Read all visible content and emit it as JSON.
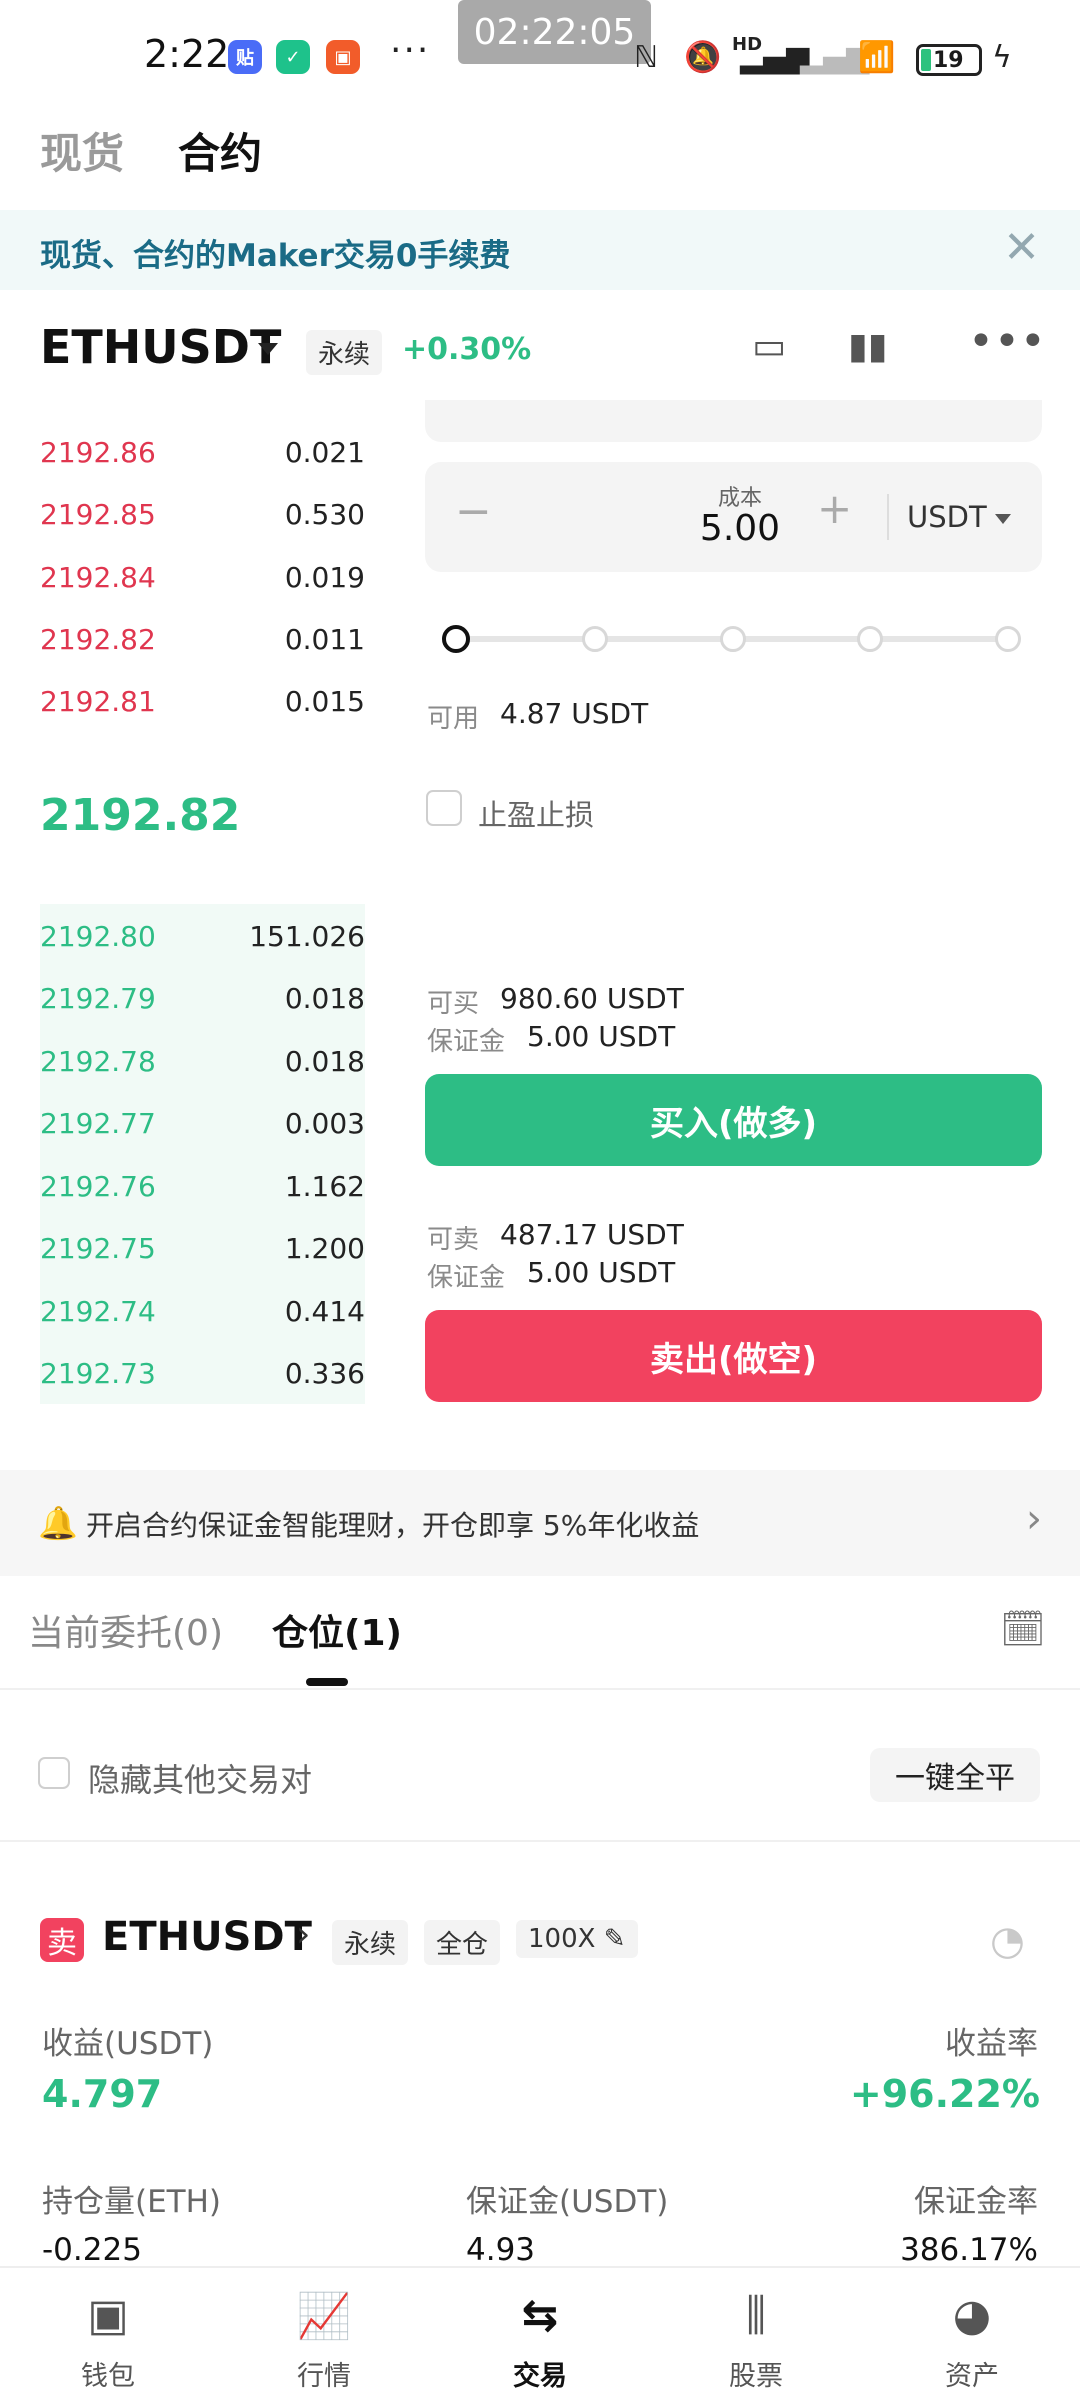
{
  "status_bar": {
    "time": "2:22",
    "dots": "···",
    "recording_clock": "02:22:05",
    "nfc": "ℕ",
    "hd": "HD",
    "battery": "19"
  },
  "top_tabs": [
    "现货",
    "合约"
  ],
  "banner": {
    "text": "现货、合约的Maker交易0手续费",
    "close": "✕"
  },
  "symbol": {
    "name": "ETHUSDT",
    "tag": "永续",
    "change": "+0.30%"
  },
  "order_book": {
    "asks": [
      {
        "price": "2192.86",
        "qty": "0.021"
      },
      {
        "price": "2192.85",
        "qty": "0.530"
      },
      {
        "price": "2192.84",
        "qty": "0.019"
      },
      {
        "price": "2192.82",
        "qty": "0.011"
      },
      {
        "price": "2192.81",
        "qty": "0.015"
      }
    ],
    "last_price": "2192.82",
    "bids": [
      {
        "price": "2192.80",
        "qty": "151.026"
      },
      {
        "price": "2192.79",
        "qty": "0.018"
      },
      {
        "price": "2192.78",
        "qty": "0.018"
      },
      {
        "price": "2192.77",
        "qty": "0.003"
      },
      {
        "price": "2192.76",
        "qty": "1.162"
      },
      {
        "price": "2192.75",
        "qty": "1.200"
      },
      {
        "price": "2192.74",
        "qty": "0.414"
      },
      {
        "price": "2192.73",
        "qty": "0.336"
      }
    ]
  },
  "order_form": {
    "cost_label": "成本",
    "cost_value": "5.00",
    "minus": "−",
    "plus": "+",
    "unit": "USDT",
    "available_label": "可用",
    "available_value": "4.87 USDT",
    "tpsl_label": "止盈止损",
    "can_buy_label": "可买",
    "can_buy_value": "980.60 USDT",
    "margin_label": "保证金",
    "buy_margin_value": "5.00 USDT",
    "buy_button": "买入(做多)",
    "can_sell_label": "可卖",
    "can_sell_value": "487.17 USDT",
    "sell_margin_value": "5.00 USDT",
    "sell_button": "卖出(做空)"
  },
  "promo": {
    "text": "开启合约保证金智能理财，开仓即享 5%年化收益"
  },
  "orders_tabs": [
    "当前委托(0)",
    "仓位(1)"
  ],
  "hide_pairs_label": "隐藏其他交易对",
  "close_all_button": "一键全平",
  "position": {
    "side": "卖",
    "symbol": "ETHUSDT",
    "chev": "›",
    "tags": [
      "永续",
      "全仓",
      "100X"
    ],
    "pnl_label": "收益(USDT)",
    "pnl_value": "4.797",
    "roe_label": "收益率",
    "roe_value": "+96.22%",
    "size_label": "持仓量(ETH)",
    "size_value": "-0.225",
    "margin_label": "保证金(USDT)",
    "margin_value": "4.93",
    "margin_ratio_label": "保证金率",
    "margin_ratio_value": "386.17%"
  },
  "bottom_nav": [
    "钱包",
    "行情",
    "交易",
    "股票",
    "资产"
  ],
  "colors": {
    "green": "#2dbd85",
    "red": "#f2425f",
    "banner_text": "#1a6b86"
  }
}
